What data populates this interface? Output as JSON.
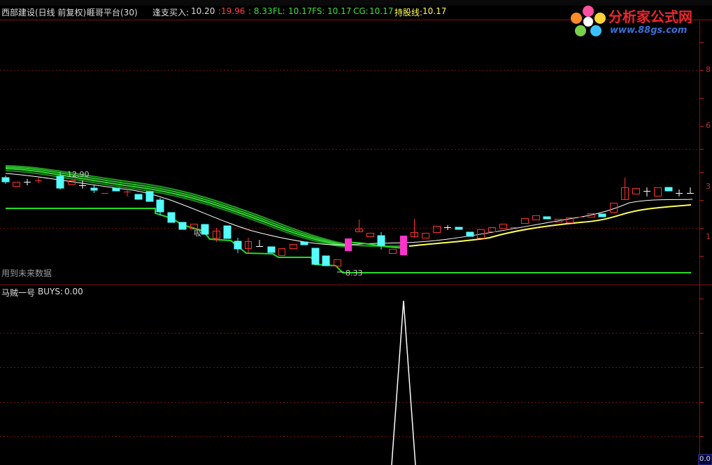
{
  "header": {
    "stock_name": "西部建设(日线 前复权)",
    "indicator_title": "睚哥平台(30)",
    "buy_label": "逢支买入:",
    "buy_value": "10.20",
    "val_red": ":19.96",
    "val_green": ": 8.33",
    "fl_label": "FL:",
    "fl_value": "10.17",
    "fs_label": "FS:",
    "fs_value": "10.17",
    "cg_label": "CG:",
    "cg_value": "10.17",
    "hold_label": "持股线:",
    "hold_value": "10.17"
  },
  "main_panel": {
    "future_data_note": "用到未来数据",
    "high_marker": "12.90",
    "low_marker": "8.33",
    "buy_marker": "吸",
    "right_axis_ticks": [
      "8",
      "6",
      "3",
      "1"
    ]
  },
  "sub_panel": {
    "indicator_name": "马贼一号",
    "buys_label": "BUYS:",
    "buys_value": "0.00",
    "bottom_value": "0.0"
  },
  "watermark": {
    "title": "分析家公式网",
    "url": "www.88gs.com"
  },
  "colors": {
    "up_candle": "#ff3030",
    "down_candle": "#54fcfc",
    "highlight_candle": "#ff33cc",
    "support_line": "#22dd22",
    "ma_yellow": "#ffff55",
    "ma_white": "#ffffff",
    "grid_red": "#8a1010"
  }
}
